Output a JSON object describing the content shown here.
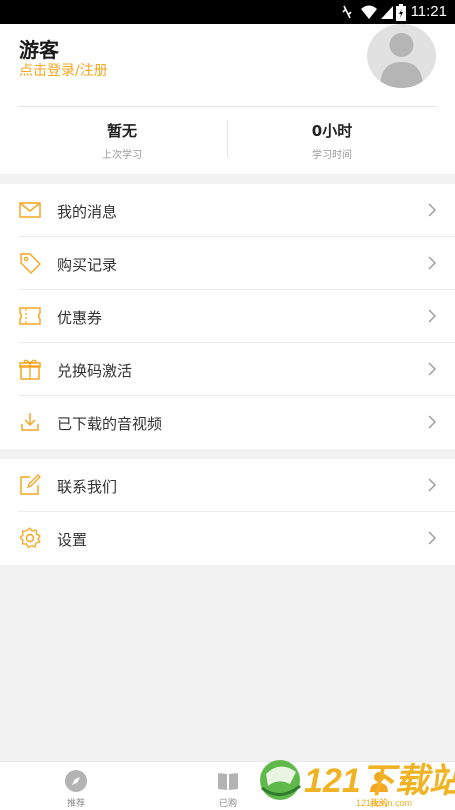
{
  "status_bar": {
    "time": "11:21"
  },
  "profile": {
    "name": "游客",
    "login_link": "点击登录/注册",
    "stats": [
      {
        "value": "暂无",
        "label": "上次学习"
      },
      {
        "value": "0小时",
        "label": "学习时间"
      }
    ]
  },
  "menu_group_1": [
    {
      "label": "我的消息",
      "icon": "mail-icon"
    },
    {
      "label": "购买记录",
      "icon": "tag-icon"
    },
    {
      "label": "优惠券",
      "icon": "coupon-icon"
    },
    {
      "label": "兑换码激活",
      "icon": "gift-icon"
    },
    {
      "label": "已下载的音视频",
      "icon": "download-icon"
    }
  ],
  "menu_group_2": [
    {
      "label": "联系我们",
      "icon": "edit-icon"
    },
    {
      "label": "设置",
      "icon": "gear-icon"
    }
  ],
  "tabbar": {
    "tabs": [
      {
        "label": "推荐",
        "icon": "compass-icon"
      },
      {
        "label": "已购",
        "icon": "book-icon"
      },
      {
        "label": "我的",
        "icon": "person-icon",
        "active": true
      }
    ]
  },
  "watermark": {
    "text": "121下载站",
    "sub": "121down.com"
  },
  "colors": {
    "accent": "#f5a623",
    "background": "#f2f2f2"
  }
}
